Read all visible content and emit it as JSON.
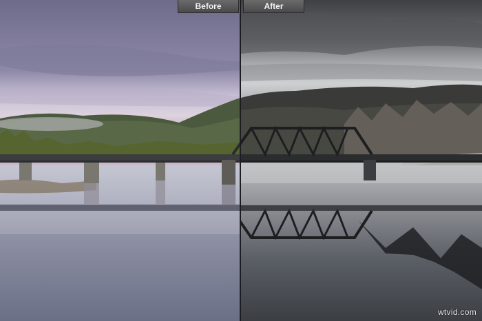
{
  "labels": {
    "before": "Before",
    "after": "After"
  },
  "watermark": "wtvid.com",
  "colors": {
    "before_sky": "#8c89a9",
    "after_sky": "#6f7174",
    "tag_bg": "#5a5a5a",
    "divider": "#1b1d20"
  }
}
